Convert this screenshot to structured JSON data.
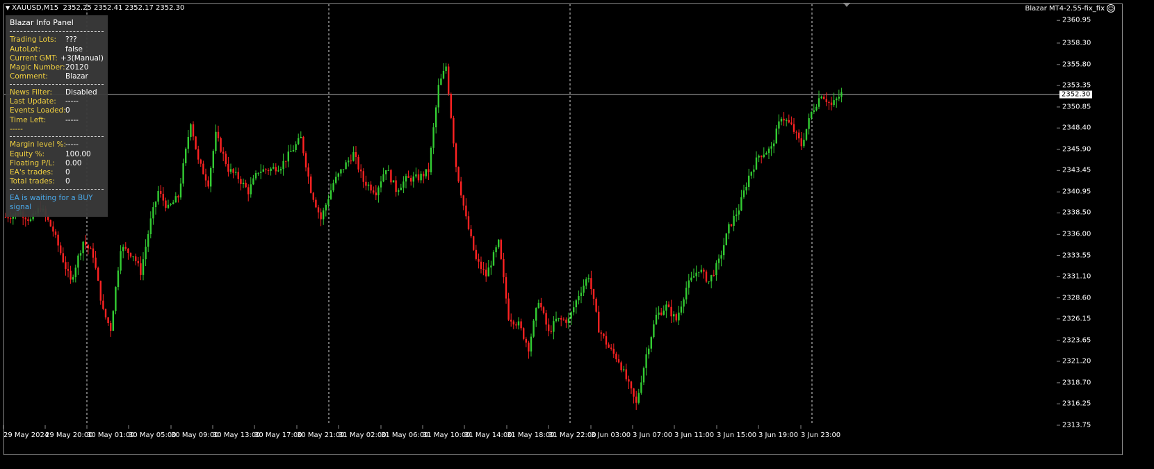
{
  "header": {
    "symbol": "XAUUSD,M15",
    "ohlc": "2352.25 2352.41 2352.17 2352.30",
    "ea_name": "Blazar MT4-2.55-fix_fix",
    "smiley": "☺"
  },
  "info_panel": {
    "title": "Blazar Info Panel",
    "section1": [
      {
        "label": "Trading Lots:",
        "value": "???"
      },
      {
        "label": "AutoLot:",
        "value": "false"
      },
      {
        "label": "Current GMT:",
        "value": "+3(Manual)"
      },
      {
        "label": "Magic Number:",
        "value": "20120"
      },
      {
        "label": "Comment:",
        "value": "Blazar"
      }
    ],
    "section2": [
      {
        "label": "News Filter:",
        "value": "Disabled"
      },
      {
        "label": "Last Update:",
        "value": "-----"
      },
      {
        "label": "Events Loaded:",
        "value": "0"
      },
      {
        "label": "Time Left:",
        "value": "-----"
      }
    ],
    "section2_extra": "-----",
    "section3": [
      {
        "label": "Margin level %:",
        "value": "-----"
      },
      {
        "label": "Equity %:",
        "value": "100.00"
      },
      {
        "label": "Floating P/L:",
        "value": "0.00"
      },
      {
        "label": "EA's trades:",
        "value": "0"
      },
      {
        "label": "Total trades:",
        "value": "0"
      }
    ],
    "signal_text": "EA is waiting for a BUY signal"
  },
  "chart_data": {
    "type": "candlestick",
    "symbol": "XAUUSD",
    "timeframe": "M15",
    "current_price": "2352.30",
    "y_ticks": [
      "2360.95",
      "2358.30",
      "2355.80",
      "2353.35",
      "2350.85",
      "2348.40",
      "2345.90",
      "2343.45",
      "2340.95",
      "2338.50",
      "2336.00",
      "2333.55",
      "2331.10",
      "2328.60",
      "2326.15",
      "2323.65",
      "2321.20",
      "2318.70",
      "2316.25",
      "2313.75"
    ],
    "ylim": [
      2313.75,
      2361.7
    ],
    "x_ticks": [
      "29 May 2024",
      "29 May 20:00",
      "30 May 01:00",
      "30 May 05:00",
      "30 May 09:00",
      "30 May 13:00",
      "30 May 17:00",
      "30 May 21:00",
      "31 May 02:00",
      "31 May 06:00",
      "31 May 10:00",
      "31 May 14:00",
      "31 May 18:00",
      "31 May 22:00",
      "3 Jun 03:00",
      "3 Jun 07:00",
      "3 Jun 11:00",
      "3 Jun 15:00",
      "3 Jun 19:00",
      "3 Jun 23:00"
    ],
    "day_separators": [
      "30 May 00:00",
      "31 May 00:00",
      "31 May 20:00",
      "3 Jun 22:00"
    ],
    "price_path": [
      [
        0,
        2338.0
      ],
      [
        6,
        2338.6
      ],
      [
        10,
        2337.6
      ],
      [
        14,
        2339.2
      ],
      [
        19,
        2336.4
      ],
      [
        23,
        2333.0
      ],
      [
        26,
        2330.5
      ],
      [
        31,
        2335.2
      ],
      [
        35,
        2333.6
      ],
      [
        39,
        2327.0
      ],
      [
        42,
        2325.0
      ],
      [
        46,
        2334.5
      ],
      [
        51,
        2333.6
      ],
      [
        54,
        2331.6
      ],
      [
        58,
        2337.6
      ],
      [
        61,
        2341.0
      ],
      [
        65,
        2339.0
      ],
      [
        69,
        2340.4
      ],
      [
        74,
        2349.2
      ],
      [
        77,
        2344.5
      ],
      [
        81,
        2342.0
      ],
      [
        84,
        2347.6
      ],
      [
        89,
        2343.6
      ],
      [
        93,
        2342.6
      ],
      [
        97,
        2341.0
      ],
      [
        101,
        2343.4
      ],
      [
        106,
        2343.6
      ],
      [
        110,
        2344.0
      ],
      [
        114,
        2345.6
      ],
      [
        118,
        2347.2
      ],
      [
        122,
        2341.2
      ],
      [
        126,
        2337.8
      ],
      [
        131,
        2342.0
      ],
      [
        135,
        2343.8
      ],
      [
        139,
        2345.4
      ],
      [
        143,
        2342.2
      ],
      [
        148,
        2341.0
      ],
      [
        152,
        2343.8
      ],
      [
        156,
        2341.2
      ],
      [
        160,
        2342.4
      ],
      [
        165,
        2342.6
      ],
      [
        169,
        2343.4
      ],
      [
        173,
        2353.2
      ],
      [
        176,
        2355.6
      ],
      [
        180,
        2344.0
      ],
      [
        184,
        2337.8
      ],
      [
        188,
        2333.0
      ],
      [
        192,
        2331.2
      ],
      [
        197,
        2335.0
      ],
      [
        201,
        2326.4
      ],
      [
        205,
        2325.5
      ],
      [
        209,
        2322.8
      ],
      [
        213,
        2328.4
      ],
      [
        217,
        2324.5
      ],
      [
        220,
        2326.0
      ],
      [
        225,
        2326.0
      ],
      [
        229,
        2329.0
      ],
      [
        233,
        2331.2
      ],
      [
        237,
        2325.0
      ],
      [
        241,
        2322.8
      ],
      [
        245,
        2321.3
      ],
      [
        249,
        2318.4
      ],
      [
        252,
        2316.2
      ],
      [
        256,
        2322.0
      ],
      [
        260,
        2326.5
      ],
      [
        264,
        2327.6
      ],
      [
        268,
        2326.0
      ],
      [
        272,
        2329.8
      ],
      [
        277,
        2332.0
      ],
      [
        281,
        2330.5
      ],
      [
        285,
        2332.8
      ],
      [
        289,
        2336.8
      ],
      [
        293,
        2339.0
      ],
      [
        297,
        2342.8
      ],
      [
        301,
        2345.2
      ],
      [
        306,
        2346.0
      ],
      [
        310,
        2349.8
      ],
      [
        314,
        2348.6
      ],
      [
        318,
        2346.4
      ],
      [
        322,
        2350.2
      ],
      [
        326,
        2352.4
      ],
      [
        330,
        2351.0
      ],
      [
        334,
        2352.4
      ]
    ]
  }
}
